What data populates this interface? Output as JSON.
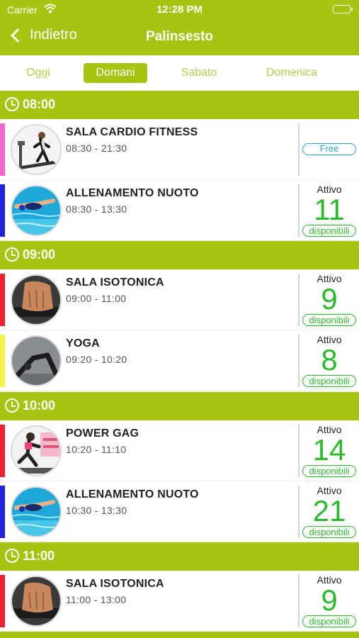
{
  "status_bar": {
    "carrier": "Carrier",
    "time": "12:28 PM"
  },
  "nav": {
    "back_label": "Indietro",
    "title": "Palinsesto"
  },
  "tabs": [
    {
      "label": "Oggi"
    },
    {
      "label": "Domani",
      "active": true
    },
    {
      "label": "Sabato"
    },
    {
      "label": "Domenica"
    }
  ],
  "sections": [
    {
      "time": "08:00",
      "items": [
        {
          "name": "SALA CARDIO FITNESS",
          "hours": "08:30 - 21:30",
          "tag": "Free",
          "color": "#ff66cc",
          "image": "treadmill"
        },
        {
          "name": "ALLENAMENTO NUOTO",
          "hours": "08:30 - 13:30",
          "status": "Attivo",
          "count": "11",
          "available": "disponibili",
          "color": "#2222dd",
          "image": "swimmer"
        }
      ]
    },
    {
      "time": "09:00",
      "items": [
        {
          "name": "SALA ISOTONICA",
          "hours": "09:00 - 11:00",
          "status": "Attivo",
          "count": "9",
          "available": "disponibili",
          "color": "#ee2233",
          "image": "dumbbell-grip"
        },
        {
          "name": "YOGA",
          "hours": "09:20 - 10:20",
          "status": "Attivo",
          "count": "8",
          "available": "disponibili",
          "color": "#f2f24a",
          "image": "yoga-pose"
        }
      ]
    },
    {
      "time": "10:00",
      "items": [
        {
          "name": "POWER GAG",
          "hours": "10:20 - 11:10",
          "status": "Attivo",
          "count": "14",
          "available": "disponibili",
          "color": "#ee2233",
          "image": "power-gag"
        },
        {
          "name": "ALLENAMENTO NUOTO",
          "hours": "10:30 - 13:30",
          "status": "Attivo",
          "count": "21",
          "available": "disponibili",
          "color": "#2222dd",
          "image": "swimmer"
        }
      ]
    },
    {
      "time": "11:00",
      "items": [
        {
          "name": "SALA ISOTONICA",
          "hours": "11:00 - 13:00",
          "status": "Attivo",
          "count": "9",
          "available": "disponibili",
          "color": "#ee2233",
          "image": "dumbbell-grip"
        }
      ]
    }
  ],
  "colors": {
    "brand": "#a6c411",
    "available": "#2bba2b",
    "free": "#2aa5c9"
  }
}
